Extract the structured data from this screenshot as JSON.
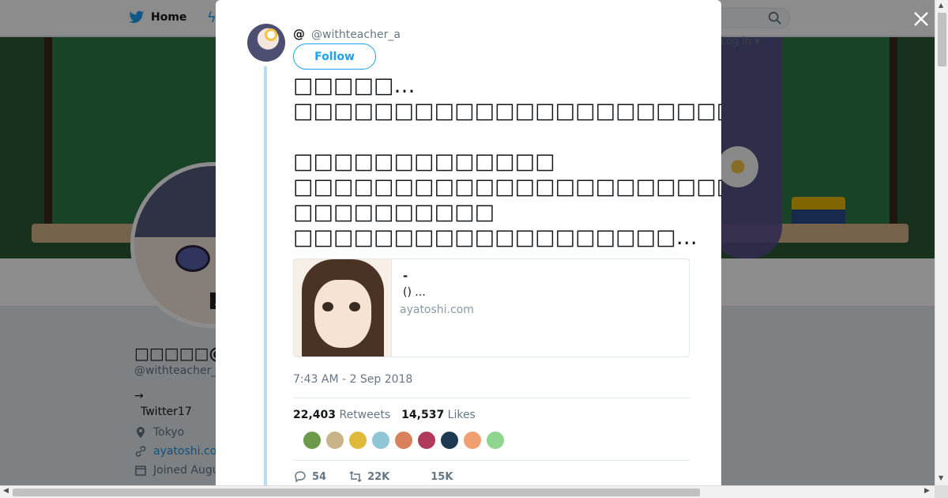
{
  "topbar": {
    "home_label": "Home",
    "login_label": "Log in ▾"
  },
  "profile": {
    "display_name": "□□□□□@□□",
    "handle": "@withteacher_",
    "bio_line1": "→",
    "bio_line2": "Twitter17",
    "location": "Tokyo",
    "website": "ayatoshi.co",
    "joined": "Joined Augu",
    "avatar_tag": "A"
  },
  "tweet": {
    "author_name": "@",
    "author_handle": "@withteacher_a",
    "follow_label": "Follow",
    "text": "□□□□□…\n□□□□□□□□□□□□□□□□□□□□□□□□□□□□□□□□□□□□□□□□□□□□□□□□□□□□□□□□□□□□□.\n\n□□□□□□□□□□□□□\n□□□□□□□□□□□□□□□□□□□□□□□\n□□□□□□□□□□\n□□□□□□□□□□□□□□□□□□□…",
    "card": {
      "title": "-",
      "description": "()  ...",
      "domain": "ayatoshi.com"
    },
    "timestamp": "7:43 AM - 2 Sep 2018",
    "retweets_count": "22,403",
    "retweets_label": "Retweets",
    "likes_count": "14,537",
    "likes_label": "Likes",
    "likers": [
      "#6c9a4a",
      "#c9b48a",
      "#e0b93a",
      "#8fc6d6",
      "#d8805c",
      "#b03a5c",
      "#1e3a52",
      "#f0a070",
      "#8fd48f"
    ],
    "actions": {
      "replies": "54",
      "retweets": "22K",
      "likes": "15K"
    }
  },
  "colors": {
    "brand": "#1da1f2",
    "text": "#14171a",
    "muted": "#657786"
  }
}
